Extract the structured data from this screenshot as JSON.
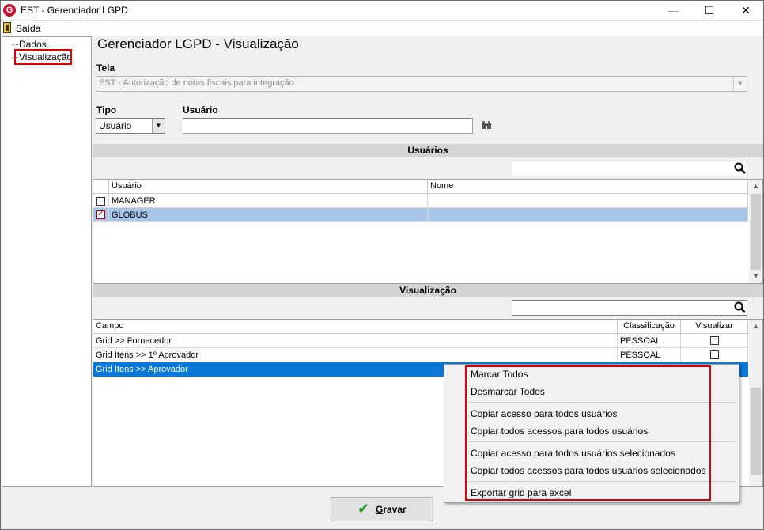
{
  "window": {
    "title": "EST - Gerenciador LGPD",
    "min": "—",
    "max": "☐",
    "close": "✕",
    "app_icon_letter": "G"
  },
  "menu": {
    "exit_label": "Saída"
  },
  "tree": {
    "items": [
      "Dados",
      "Visualização"
    ]
  },
  "page": {
    "title": "Gerenciador LGPD - Visualização"
  },
  "tela": {
    "label": "Tela",
    "value": "EST - Autorização de notas fiscais para integração"
  },
  "tipo": {
    "label": "Tipo",
    "value": "Usuário"
  },
  "usuario": {
    "label": "Usuário",
    "value": ""
  },
  "usuarios_section": {
    "title": "Usuários",
    "columns": [
      "Usuário",
      "Nome"
    ],
    "rows": [
      {
        "checked": false,
        "usuario": "MANAGER",
        "nome": ""
      },
      {
        "checked": true,
        "usuario": "GLOBUS",
        "nome": ""
      }
    ]
  },
  "visual_section": {
    "title": "Visualização",
    "columns": [
      "Campo",
      "Classificação",
      "Visualizar"
    ],
    "rows": [
      {
        "campo": "Grid >> Fornecedor",
        "classificacao": "PESSOAL"
      },
      {
        "campo": "Grid Itens >> 1º Aprovador",
        "classificacao": "PESSOAL"
      },
      {
        "campo": "Grid Itens >> Aprovador",
        "classificacao": ""
      }
    ]
  },
  "context_menu": {
    "items": [
      "Marcar Todos",
      "Desmarcar Todos",
      "Copiar acesso para todos usuários",
      "Copiar todos acessos para todos usuários",
      "Copiar acesso para todos usuários selecionados",
      "Copiar todos acessos para todos usuários selecionados",
      "Exportar grid para excel"
    ]
  },
  "save_button": {
    "label": "Gravar",
    "mnemonic": "G",
    "label_rest": "ravar"
  },
  "colors": {
    "highlight_red": "#e00000",
    "selection_blue": "#0a78d7",
    "checked_row": "#a8c4e8",
    "save_check": "#1a9a2a"
  }
}
